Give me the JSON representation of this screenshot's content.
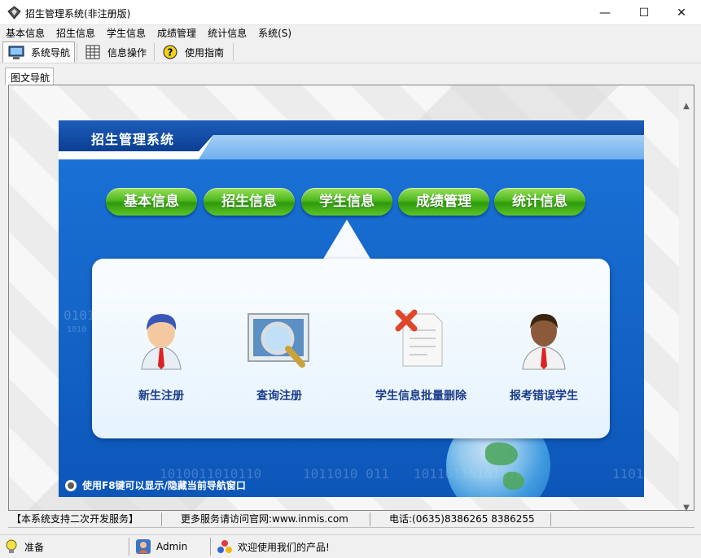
{
  "window": {
    "title": "招生管理系统(非注册版)",
    "controls": {
      "minimize": "—",
      "maximize": "☐",
      "close": "✕"
    }
  },
  "menu": [
    {
      "label": "基本信息"
    },
    {
      "label": "招生信息"
    },
    {
      "label": "学生信息"
    },
    {
      "label": "成绩管理"
    },
    {
      "label": "统计信息"
    },
    {
      "label": "系统(S)"
    }
  ],
  "toolbar": {
    "nav_label": "系统导航",
    "info_label": "信息操作",
    "guide_label": "使用指南"
  },
  "doc_tab": {
    "label": "图文导航"
  },
  "panel": {
    "title": "招生管理系统",
    "tabs": [
      {
        "label": "基本信息"
      },
      {
        "label": "招生信息"
      },
      {
        "label": "学生信息"
      },
      {
        "label": "成绩管理"
      },
      {
        "label": "统计信息"
      }
    ],
    "selected_tab": "学生信息",
    "features": [
      {
        "label": "新生注册",
        "icon": "male-user-icon"
      },
      {
        "label": "查询注册",
        "icon": "magnifier-icon"
      },
      {
        "label": "学生信息批量删除",
        "icon": "delete-document-icon"
      },
      {
        "label": "报考错误学生",
        "icon": "student-user-icon"
      }
    ],
    "hint": "使用F8键可以显示/隐藏当前导航窗口",
    "binary_texts": [
      "1010011010110",
      "1011010  011",
      "10110110101010",
      "0101",
      "1010",
      "1101"
    ]
  },
  "infobar": {
    "support": "【本系统支持二次开发服务】",
    "website": "更多服务请访问官网:www.inmis.com",
    "phone": "电话:(0635)8386265 8386255"
  },
  "statusbar": {
    "status": "准备",
    "user": "Admin",
    "welcome": "欢迎使用我们的产品!"
  },
  "colors": {
    "panel_blue": "#1567c9",
    "header_dark": "#0b3f93",
    "pill_green": "#4eb91e",
    "label_navy": "#1a3c8a"
  }
}
